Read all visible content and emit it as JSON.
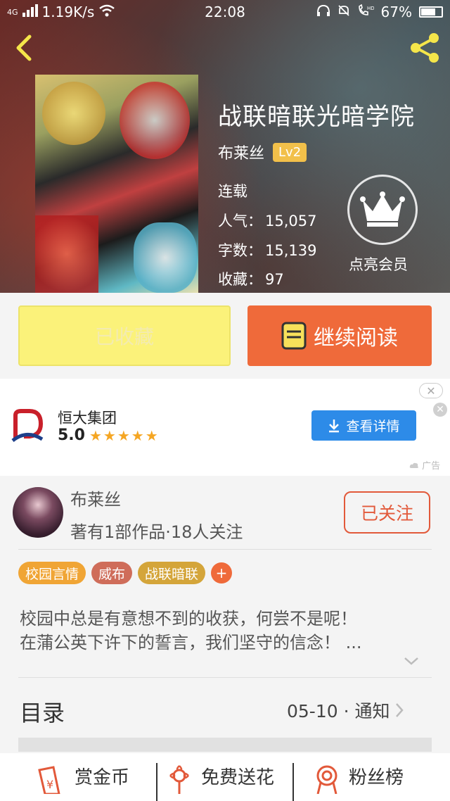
{
  "status_bar": {
    "network": "4G",
    "speed": "1.19K/s",
    "time": "22:08",
    "battery": "67%"
  },
  "book": {
    "title": "战联暗联光暗学院",
    "author": "布莱丝",
    "level": "Lv2",
    "status": "连载",
    "popularity_label": "人气：",
    "popularity": "15,057",
    "words_label": "字数：",
    "words": "15,139",
    "favorites_label": "收藏：",
    "favorites": "97",
    "member_label": "点亮会员"
  },
  "actions": {
    "favorited_label": "已收藏",
    "continue_label": "继续阅读"
  },
  "ad": {
    "name": "恒大集团",
    "score": "5.0",
    "stars": "★★★★★",
    "button_label": "查看详情",
    "tag": "广告",
    "close_symbol": "✕",
    "dismiss_symbol": "✕"
  },
  "author_info": {
    "name": "布莱丝",
    "stats": "著有1部作品·18人关注",
    "follow_label": "已关注"
  },
  "tags": [
    {
      "label": "校园言情",
      "color": "#f0a535"
    },
    {
      "label": "威布",
      "color": "#cf6d5a"
    },
    {
      "label": "战联暗联",
      "color": "#d4a53a"
    }
  ],
  "tag_add": "+",
  "description": {
    "line1": "校园中总是有意想不到的收获，何尝不是呢！",
    "line2": "在蒲公英下许下的誓言，我们坚守的信念！ ..."
  },
  "toc": {
    "label": "目录",
    "latest": "05-10 · 通知"
  },
  "bottom_actions": [
    {
      "label": "赏金币",
      "icon": "reward-icon"
    },
    {
      "label": "免费送花",
      "icon": "flower-icon"
    },
    {
      "label": "粉丝榜",
      "icon": "medal-icon"
    }
  ],
  "colors": {
    "accent": "#ef6a3a",
    "favorited_bg": "#fbf27a",
    "ad_button": "#2d8be8",
    "level_badge": "#f2c04a"
  }
}
